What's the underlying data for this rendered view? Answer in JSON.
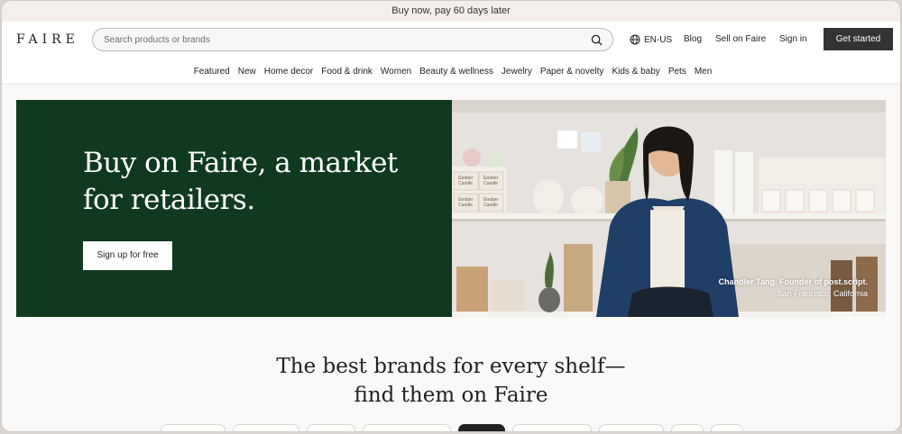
{
  "promo_text": "Buy now, pay 60 days later",
  "header": {
    "logo": "FAIRE",
    "search_placeholder": "Search products or brands",
    "locale": "EN-US",
    "blog": "Blog",
    "sell": "Sell on Faire",
    "sign_in": "Sign in",
    "get_started": "Get started"
  },
  "categories": [
    "Featured",
    "New",
    "Home decor",
    "Food & drink",
    "Women",
    "Beauty & wellness",
    "Jewelry",
    "Paper & novelty",
    "Kids & baby",
    "Pets",
    "Men"
  ],
  "hero": {
    "title_line1": "Buy on Faire, a market",
    "title_line2": "for retailers.",
    "button": "Sign up for free",
    "caption_name": "Chandler Tang, Founder of post.script.",
    "caption_location": "San Francisco, California",
    "box_label": "Goober Candle",
    "bg_color": "#0f3a1f"
  },
  "section": {
    "line1": "The best brands for every shelf—",
    "line2": "find them on Faire"
  }
}
